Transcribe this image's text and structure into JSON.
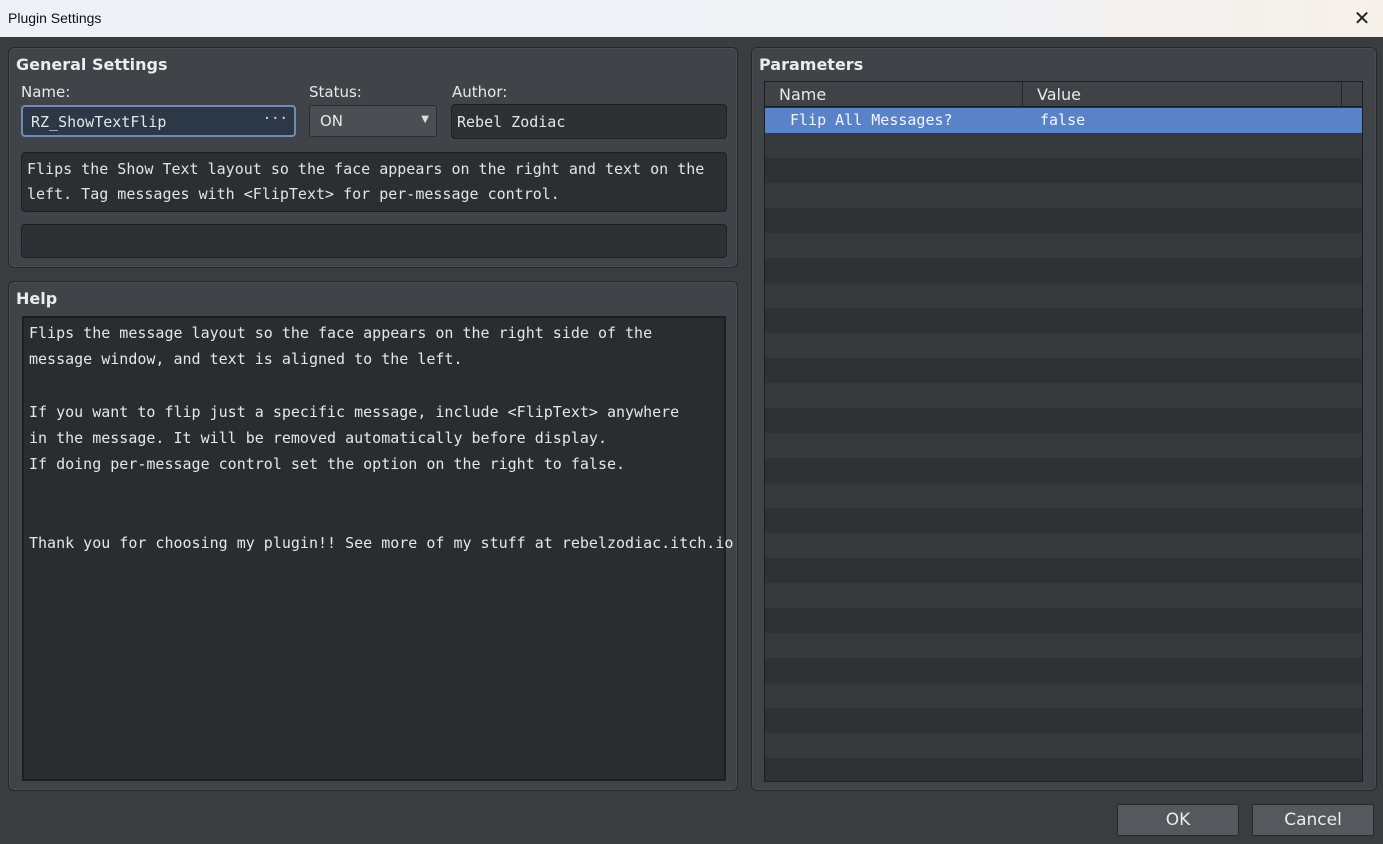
{
  "window": {
    "title": "Plugin Settings",
    "close_glyph": "✕"
  },
  "general": {
    "title": "General Settings",
    "name_label": "Name:",
    "name_value": "RZ_ShowTextFlip",
    "name_browse": "···",
    "status_label": "Status:",
    "status_value": "ON",
    "author_label": "Author:",
    "author_value": "Rebel Zodiac",
    "description": [
      "Flips the Show Text layout so the face appears on the right and text on the",
      "left. Tag messages with <FlipText> for per-message control."
    ],
    "url_value": ""
  },
  "help": {
    "title": "Help",
    "lines": [
      "Flips the message layout so the face appears on the right side of the",
      "message window, and text is aligned to the left.",
      "",
      "If you want to flip just a specific message, include <FlipText> anywhere",
      "in the message. It will be removed automatically before display.",
      "If doing per-message control set the option on the right to false.",
      "",
      "",
      "Thank you for choosing my plugin!! See more of my stuff at rebelzodiac.itch.io"
    ]
  },
  "parameters": {
    "title": "Parameters",
    "columns": [
      "Name",
      "Value"
    ],
    "rows": [
      {
        "name": "Flip All Messages?",
        "value": "false",
        "selected": true
      }
    ]
  },
  "buttons": {
    "ok": "OK",
    "cancel": "Cancel"
  },
  "colors": {
    "background": "#3a3d40",
    "panel": "#404347",
    "selection": "#5a82c9",
    "focus_border": "#6f8cb8"
  }
}
